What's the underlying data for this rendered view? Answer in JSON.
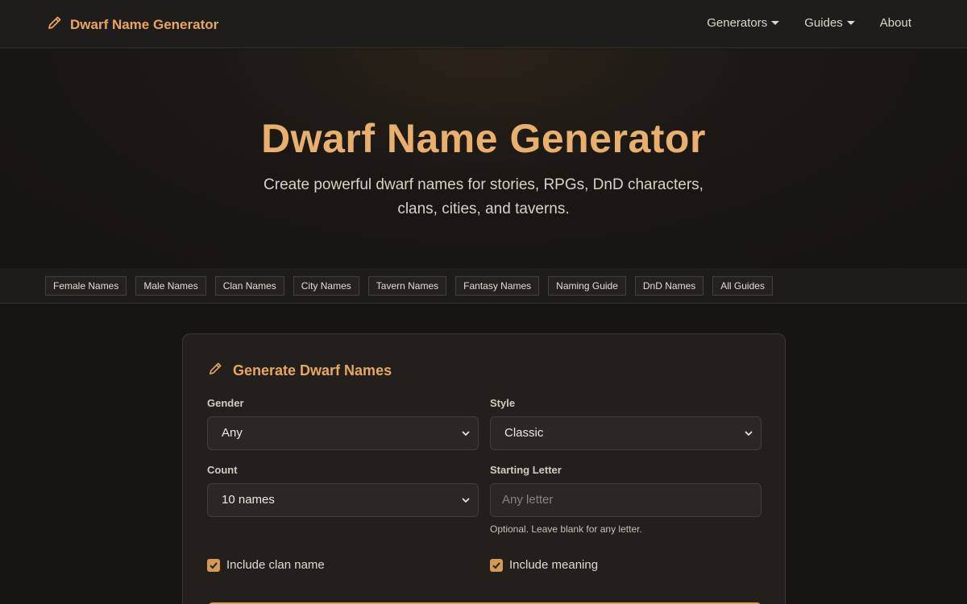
{
  "navbar": {
    "brand_icon": "pencil-icon",
    "brand_label": "Dwarf Name Generator",
    "links": [
      {
        "label": "Generators",
        "dropdown": true
      },
      {
        "label": "Guides",
        "dropdown": true
      },
      {
        "label": "About",
        "dropdown": false
      }
    ]
  },
  "hero": {
    "title": "Dwarf Name Generator",
    "subtitle": "Create powerful dwarf names for stories, RPGs, DnD characters, clans, cities, and taverns."
  },
  "quick_links": [
    "Female Names",
    "Male Names",
    "Clan Names",
    "City Names",
    "Tavern Names",
    "Fantasy Names",
    "Naming Guide",
    "DnD Names",
    "All Guides"
  ],
  "form": {
    "title_icon": "pencil-icon",
    "title": "Generate Dwarf Names",
    "gender": {
      "label": "Gender",
      "value": "Any"
    },
    "style": {
      "label": "Style",
      "value": "Classic"
    },
    "count": {
      "label": "Count",
      "value": "10 names"
    },
    "starting_letter": {
      "label": "Starting Letter",
      "placeholder": "Any letter",
      "help": "Optional. Leave blank for any letter."
    },
    "include_clan": {
      "label": "Include clan name",
      "checked": true
    },
    "include_meaning": {
      "label": "Include meaning",
      "checked": true
    }
  },
  "colors": {
    "accent": "#e8a75e",
    "background": "#171513",
    "card": "#221f1c",
    "checkbox": "#d49a52"
  }
}
